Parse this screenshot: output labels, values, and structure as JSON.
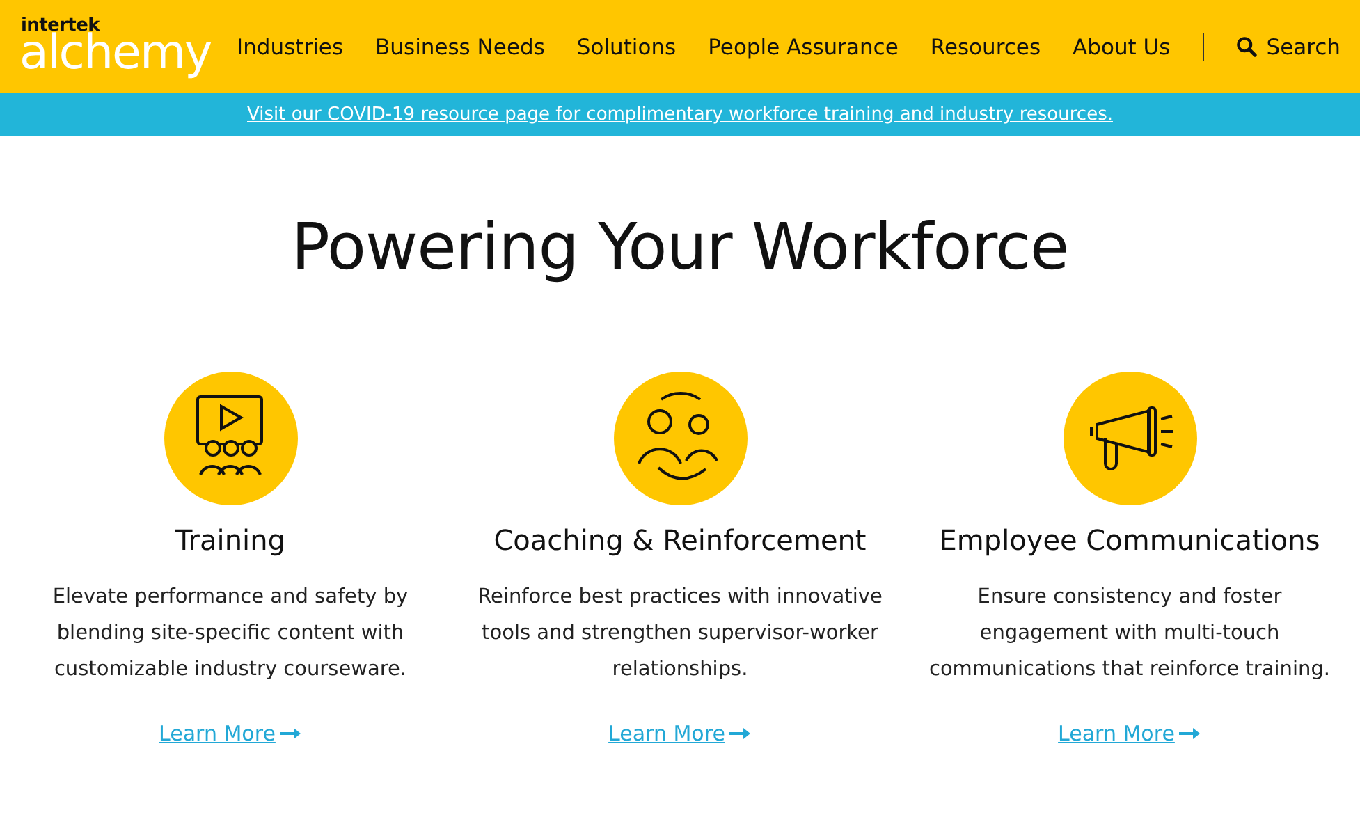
{
  "logo": {
    "company": "intertek",
    "product": "alchemy"
  },
  "nav": {
    "items": [
      "Industries",
      "Business Needs",
      "Solutions",
      "People Assurance",
      "Resources",
      "About Us"
    ],
    "search": "Search"
  },
  "banner": {
    "link": "Visit our COVID-19 resource page for complimentary workforce training and industry resources."
  },
  "heading": "Powering Your Workforce",
  "cards": [
    {
      "kind": "video",
      "title": "Training",
      "text": "Elevate performance and safety by blending site-specific content with customizable industry courseware.",
      "link": "Learn More"
    },
    {
      "kind": "people",
      "title": "Coaching & Reinforcement",
      "text": "Reinforce best practices with innovative tools and strengthen supervisor-worker relationships.",
      "link": "Learn More"
    },
    {
      "kind": "megaphone",
      "title": "Employee Communications",
      "text": "Ensure consistency and foster engagement with multi-touch communications that reinforce training.",
      "link": "Learn More"
    }
  ]
}
